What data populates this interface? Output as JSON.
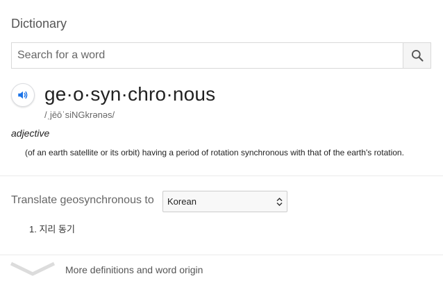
{
  "card": {
    "title": "Dictionary"
  },
  "search": {
    "placeholder": "Search for a word"
  },
  "entry": {
    "headword": "ge·o·syn·chro·nous",
    "phonetic": "/ˌjēōˈsiNGkrənəs/",
    "part_of_speech": "adjective",
    "definition": "(of an earth satellite or its orbit) having a period of rotation synchronous with that of the earth's rotation."
  },
  "translate": {
    "label": "Translate geosynchronous to",
    "selected_language": "Korean",
    "results": [
      {
        "number": "1.",
        "text": "지리 동기"
      }
    ]
  },
  "footer": {
    "more_label": "More definitions and word origin"
  },
  "colors": {
    "speaker_icon": "#1a73e8",
    "divider": "#ebebeb"
  }
}
